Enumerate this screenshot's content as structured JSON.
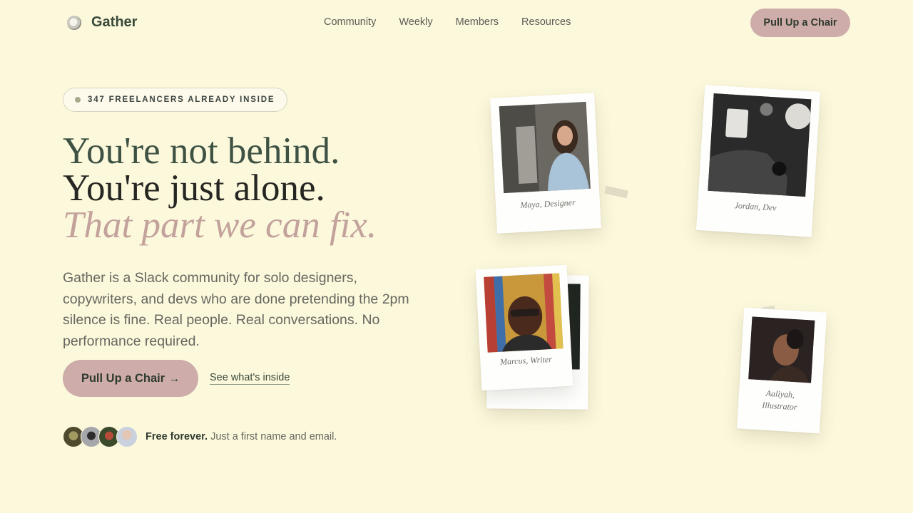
{
  "nav": {
    "brand": "Gather",
    "links": [
      "Community",
      "Weekly",
      "Members",
      "Resources"
    ],
    "cta": "Pull Up a Chair"
  },
  "hero": {
    "pill": "347 FREELANCERS ALREADY INSIDE",
    "headline": {
      "line1": "You're not behind.",
      "line2": "You're just alone.",
      "line3": "That part we can fix."
    },
    "lede": "Gather is a Slack community for solo designers, copywriters, and devs who are done pretending the 2pm silence is fine. Real people. Real conversations. No performance required.",
    "cta": "Pull Up a Chair",
    "cta_arrow": "→",
    "secondary_link": "See what's inside",
    "note_bold": "Free forever.",
    "note_text": "Just a first name and email."
  },
  "members": [
    {
      "caption": "Maya, Designer"
    },
    {
      "caption": "Jordan, Dev"
    },
    {
      "caption": "Marcus, Writer"
    },
    {
      "caption": "Aaliyah, Illustrator"
    }
  ],
  "colors": {
    "background": "#fcf8dc",
    "accent": "#cdaca9",
    "headline_green": "#3e5244",
    "headline_rose": "#c3a29c"
  }
}
